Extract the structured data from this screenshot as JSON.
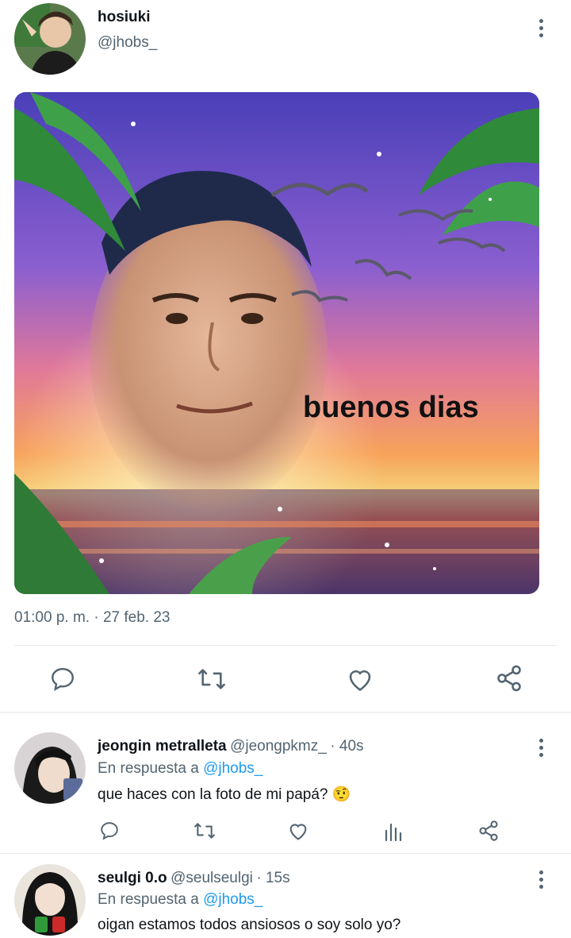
{
  "main_tweet": {
    "author_name": "hosiuki",
    "author_handle": "@jhobs_",
    "image_caption": "buenos dias",
    "timestamp": "01:00 p. m. · 27 feb. 23",
    "actions": [
      "reply-icon",
      "retweet-icon",
      "like-icon",
      "share-icon"
    ]
  },
  "replies": [
    {
      "author_name": "jeongin metralleta",
      "author_handle": "@jeongpkmz_",
      "time": "· 40s",
      "reply_prefix": "En respuesta a",
      "reply_target": "@jhobs_",
      "text": "que haces con la foto de mi papá?",
      "emoji": "🤨",
      "actions": [
        "reply-icon",
        "retweet-icon",
        "like-icon",
        "analytics-icon",
        "share-icon"
      ]
    },
    {
      "author_name": "seulgi 0.o",
      "author_handle": "@seulseulgi",
      "time": "· 15s",
      "reply_prefix": "En respuesta a",
      "reply_target": "@jhobs_",
      "text": "oigan estamos todos ansiosos o soy solo yo?"
    }
  ],
  "colors": {
    "text_primary": "#0f1419",
    "text_secondary": "#536471",
    "link": "#1d9bf0",
    "divider": "#e6e9ec"
  }
}
